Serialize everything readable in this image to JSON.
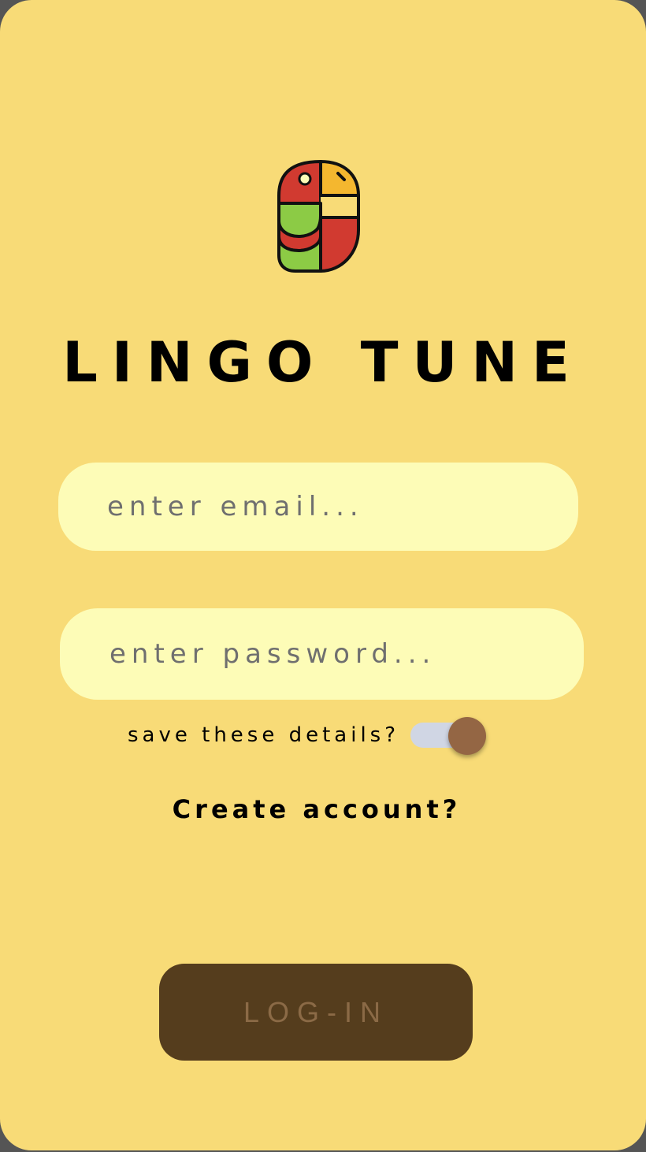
{
  "app": {
    "title": "LINGO TUNE",
    "logo_icon": "parrot-logo-icon"
  },
  "login_form": {
    "email_placeholder": "enter email...",
    "email_value": "",
    "password_placeholder": "enter password...",
    "password_value": "",
    "save_details_label": "save these details?",
    "save_details_on": true,
    "create_account_label": "Create account?",
    "login_button_label": "LOG-IN"
  },
  "colors": {
    "background": "#F8DB77",
    "input_fill": "#FDFCB7",
    "button_fill": "#553D1D",
    "button_text": "#8B6A46",
    "toggle_thumb": "#946644",
    "toggle_track": "#D0D6E4"
  }
}
